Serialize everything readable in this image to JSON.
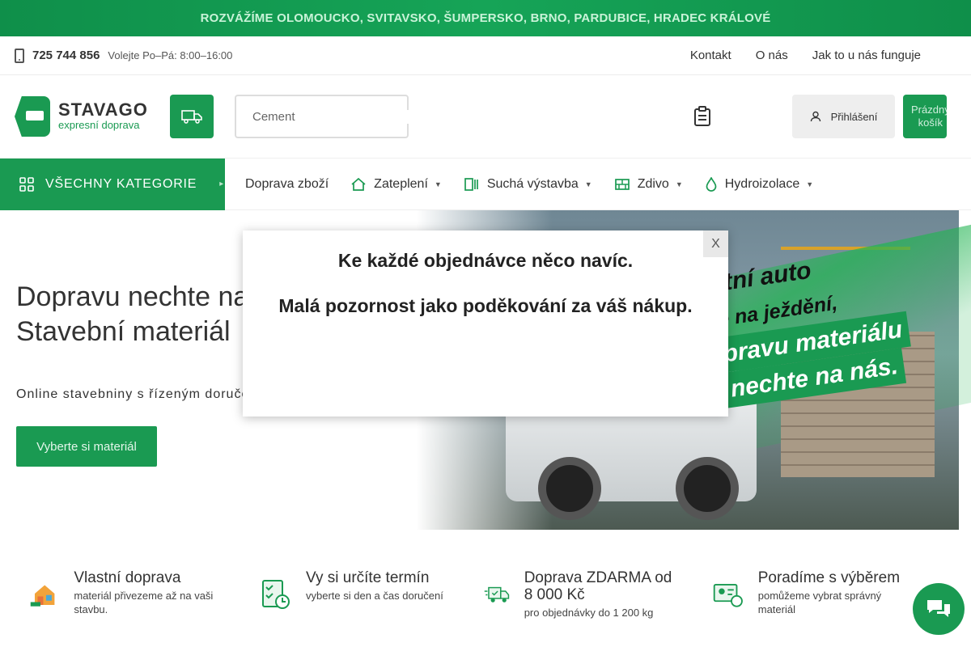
{
  "topbar": {
    "text": "ROZVÁŽÍME OLOMOUCKO, SVITAVSKO, ŠUMPERSKO, BRNO, PARDUBICE, HRADEC KRÁLOVÉ"
  },
  "infobar": {
    "phone": "725 744 856",
    "hours": "Volejte Po–Pá: 8:00–16:00",
    "links": {
      "contact": " Kontakt",
      "about": "O nás",
      "how": "Jak to u nás funguje",
      "extra": ""
    }
  },
  "header": {
    "logo_brand": "STAVAGO",
    "logo_tag": "expresní doprava",
    "search_placeholder": "Cement",
    "login_label": "Přihlášení",
    "cart_line1": "Prázdný",
    "cart_line2": "košík"
  },
  "nav": {
    "all_categories": "VŠECHNY KATEGORIE",
    "items": [
      "Doprava zboží",
      "Zateplení",
      "Suchá výstavba",
      "Zdivo",
      "Hydroizolace"
    ],
    "right_icon": ""
  },
  "hero": {
    "heading_line1": "Dopravu nechte na",
    "heading_line2": "Stavební materiál",
    "subtitle": "Online stavebniny s řízeným doruče",
    "cta": "Vyberte si materiál",
    "slogan": [
      "vlastní auto",
      "máte na ježdění,",
      "dopravu materiálu",
      "nechte na nás."
    ]
  },
  "modal": {
    "line1": " Ke každé objednávce něco navíc.",
    "line2": "Malá pozornost jako poděkování za váš nákup.",
    "close": "X"
  },
  "features": [
    {
      "title": "Vlastní doprava",
      "sub": "materiál přivezeme až na vaši stavbu."
    },
    {
      "title": "Vy si určíte termín",
      "sub": "vyberte si den a čas doručení"
    },
    {
      "title": "Doprava ZDARMA od 8 000 Kč",
      "sub": "pro objednávky do 1 200 kg"
    },
    {
      "title": "Poradíme s výběrem",
      "sub": "pomůžeme vybrat správný materiál"
    }
  ],
  "colors": {
    "brand_green": "#1a9a52",
    "topbar_green": "#16a457"
  }
}
